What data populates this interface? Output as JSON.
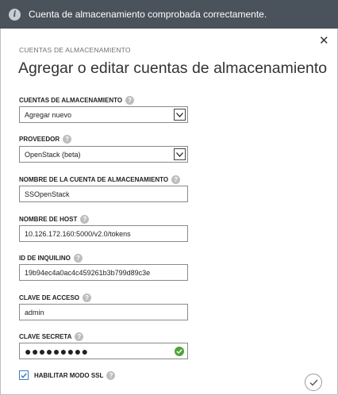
{
  "notification": {
    "icon": "info-icon",
    "message": "Cuenta de almacenamiento comprobada correctamente."
  },
  "dialog": {
    "eyebrow": "CUENTAS DE ALMACENAMIENTO",
    "title": "Agregar o editar cuentas de almacenamiento",
    "close_icon": "close-icon",
    "close_glyph": "✕"
  },
  "fields": {
    "storage_accounts": {
      "label": "CUENTAS DE ALMACENAMIENTO",
      "value": "Agregar nuevo"
    },
    "provider": {
      "label": "PROVEEDOR",
      "value": "OpenStack (beta)"
    },
    "account_name": {
      "label": "NOMBRE DE LA CUENTA DE ALMACENAMIENTO",
      "value": "SSOpenStack"
    },
    "host_name": {
      "label": "NOMBRE DE HOST",
      "value": "10.126.172.160:5000/v2.0/tokens"
    },
    "tenant_id": {
      "label": "ID DE INQUILINO",
      "value": "19b94ec4a0ac4c459261b3b799d89c3e"
    },
    "access_key": {
      "label": "CLAVE DE ACCESO",
      "value": "admin"
    },
    "secret_key": {
      "label": "CLAVE SECRETA",
      "value": "●●●●●●●●●"
    }
  },
  "ssl": {
    "label": "HABILITAR MODO SSL",
    "checked": true
  },
  "help_glyph": "?",
  "colors": {
    "notification_bg": "#4a525c",
    "valid": "#4fa33b",
    "checkbox": "#3a7cc4"
  }
}
